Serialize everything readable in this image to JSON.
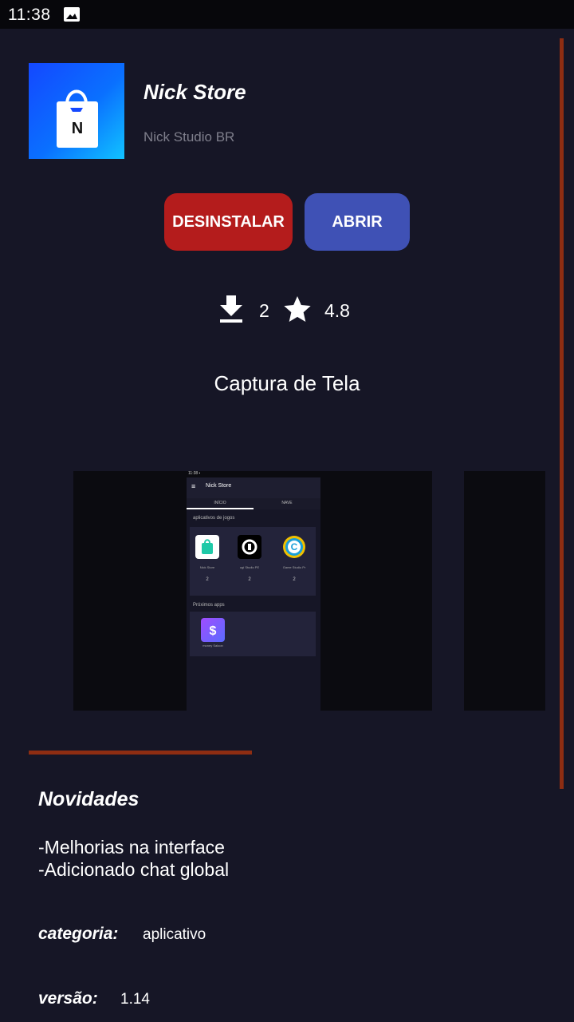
{
  "status_bar": {
    "time": "11:38"
  },
  "app": {
    "name": "Nick Store",
    "developer": "Nick Studio BR",
    "icon_letter": "N"
  },
  "actions": {
    "uninstall_label": "DESINSTALAR",
    "open_label": "ABRIR"
  },
  "stats": {
    "downloads": "2",
    "rating": "4.8"
  },
  "screenshots": {
    "title": "Captura de Tela",
    "preview": {
      "status_time": "11:38 ▪",
      "menu_glyph": "≡",
      "app_title": "Nick Store",
      "tabs": [
        "INÍCIO",
        "NAVE"
      ],
      "section_heading": "aplicativos de jogos",
      "apps": [
        {
          "name": "Nick Store",
          "downloads": "2"
        },
        {
          "name": "ogi Studio PE",
          "downloads": "2"
        },
        {
          "name": "Game Studio Pr",
          "downloads": "2"
        }
      ],
      "section2_heading": "Próximos apps",
      "apps2": [
        {
          "name": "money Saloon"
        }
      ]
    }
  },
  "changelog": {
    "title": "Novidades",
    "lines": [
      "-Melhorias na interface",
      "-Adicionado chat global"
    ]
  },
  "meta": {
    "category_label": "categoria:",
    "category_value": "aplicativo",
    "version_label": "versão:",
    "version_value": "1.14"
  },
  "colors": {
    "background": "#161626",
    "accent": "#8e2d12",
    "uninstall": "#b41c1c",
    "open": "#3f51b5"
  },
  "icons": {
    "status": "image-icon",
    "app": "shopping-bag-icon",
    "downloads": "download-icon",
    "rating": "star-icon"
  }
}
